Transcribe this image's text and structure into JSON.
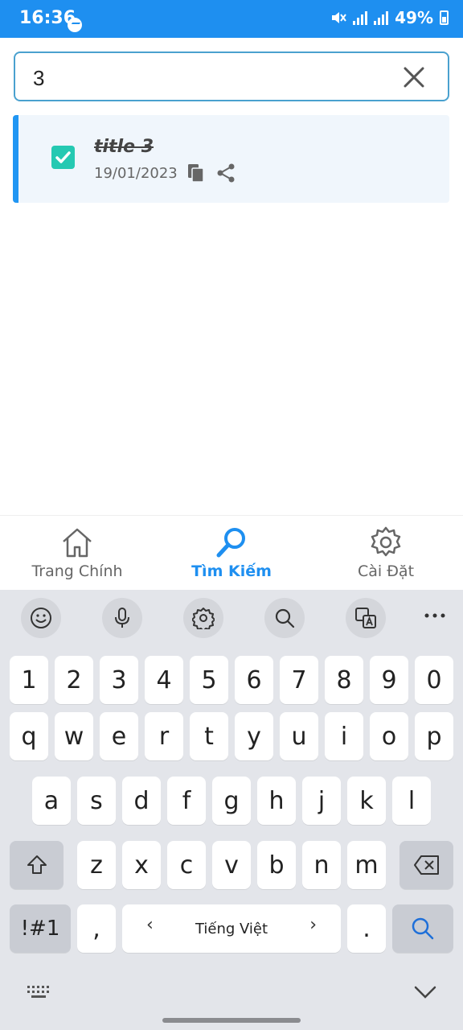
{
  "status_bar": {
    "time": "16:36",
    "battery": "49%"
  },
  "search": {
    "value": "3",
    "placeholder": ""
  },
  "note": {
    "title": "title 3",
    "date": "19/01/2023",
    "checked": true
  },
  "nav": [
    {
      "label": "Trang Chính",
      "icon": "home-icon",
      "active": false
    },
    {
      "label": "Tìm Kiếm",
      "icon": "search-icon",
      "active": true
    },
    {
      "label": "Cài Đặt",
      "icon": "gear-icon",
      "active": false
    }
  ],
  "colors": {
    "accent": "#1e8ff0",
    "checkbox": "#25c9b2",
    "card_bg": "#f0f6fc"
  },
  "keyboard": {
    "toolbar": [
      "emoji-icon",
      "mic-icon",
      "settings-icon",
      "search-icon",
      "translate-icon",
      "more-icon"
    ],
    "row1": [
      "1",
      "2",
      "3",
      "4",
      "5",
      "6",
      "7",
      "8",
      "9",
      "0"
    ],
    "row2": [
      "q",
      "w",
      "e",
      "r",
      "t",
      "y",
      "u",
      "i",
      "o",
      "p"
    ],
    "row3": [
      "a",
      "s",
      "d",
      "f",
      "g",
      "h",
      "j",
      "k",
      "l"
    ],
    "row4": [
      "z",
      "x",
      "c",
      "v",
      "b",
      "n",
      "m"
    ],
    "symbols_label": "!#1",
    "comma": ",",
    "space_label": "Tiếng Việt",
    "period": "."
  }
}
